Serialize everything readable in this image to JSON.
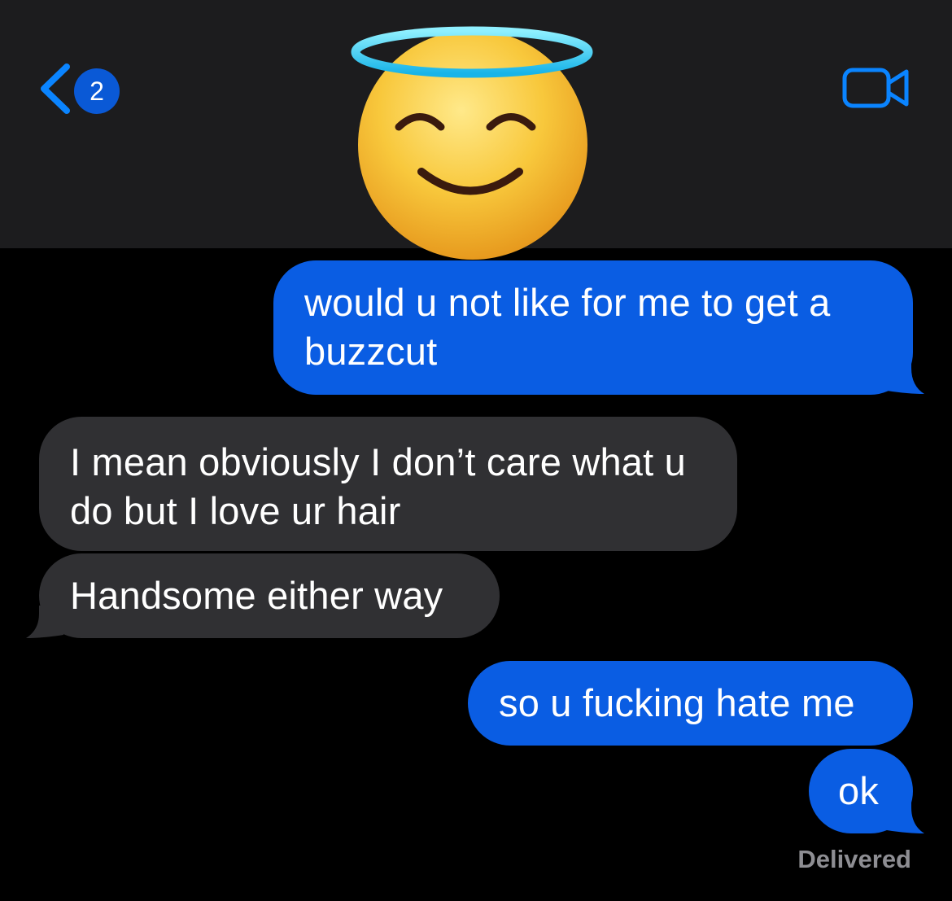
{
  "header": {
    "back_badge_count": "2",
    "accent_color": "#0a84ff",
    "back_icon": "chevron-left-icon",
    "video_icon": "video-camera-icon",
    "avatar_icon": "smiling-face-with-halo-icon"
  },
  "messages": [
    {
      "direction": "outgoing",
      "text": "would u not like for me to get a buzzcut"
    },
    {
      "direction": "incoming",
      "text": "I mean obviously I don’t care what u do but I love ur hair"
    },
    {
      "direction": "incoming",
      "text": "Handsome either way"
    },
    {
      "direction": "outgoing",
      "text": "so u fucking hate me"
    },
    {
      "direction": "outgoing",
      "text": "ok"
    }
  ],
  "status": {
    "delivered_label": "Delivered"
  },
  "colors": {
    "outgoing_bubble": "#0a5de3",
    "incoming_bubble": "#303033",
    "header_bg": "#1c1c1e",
    "background": "#000000"
  }
}
